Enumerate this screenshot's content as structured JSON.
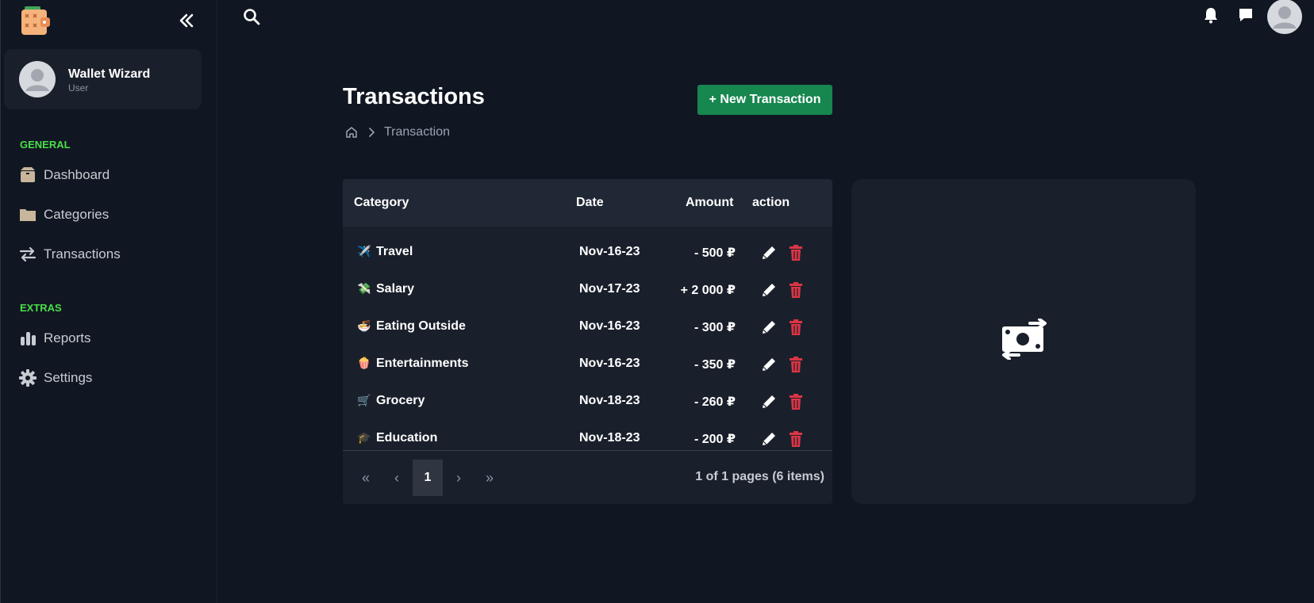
{
  "sidebar": {
    "user": {
      "name": "Wallet Wizard",
      "role": "User"
    },
    "sections": [
      {
        "title": "GENERAL",
        "items": [
          {
            "label": "Dashboard",
            "icon": "box-icon"
          },
          {
            "label": "Categories",
            "icon": "folder-icon"
          },
          {
            "label": "Transactions",
            "icon": "arrows-exchange-icon"
          }
        ]
      },
      {
        "title": "EXTRAS",
        "items": [
          {
            "label": "Reports",
            "icon": "bar-chart-icon"
          },
          {
            "label": "Settings",
            "icon": "gear-icon"
          }
        ]
      }
    ]
  },
  "header": {
    "title": "Transactions",
    "new_button": "+ New Transaction",
    "breadcrumb": "Transaction"
  },
  "table": {
    "columns": [
      "Category",
      "Date",
      "Amount",
      "action"
    ],
    "rows": [
      {
        "emoji": "✈️",
        "category": "Travel",
        "date": "Nov-16-23",
        "amount": "- 500 ₽"
      },
      {
        "emoji": "💸",
        "category": "Salary",
        "date": "Nov-17-23",
        "amount": "+ 2 000 ₽"
      },
      {
        "emoji": "🍜",
        "category": "Eating Outside",
        "date": "Nov-16-23",
        "amount": "- 300 ₽"
      },
      {
        "emoji": "🍿",
        "category": "Entertainments",
        "date": "Nov-16-23",
        "amount": "- 350 ₽"
      },
      {
        "emoji": "🛒",
        "category": "Grocery",
        "date": "Nov-18-23",
        "amount": "- 260 ₽"
      },
      {
        "emoji": "🎓",
        "category": "Education",
        "date": "Nov-18-23",
        "amount": "- 200 ₽"
      }
    ],
    "pagination": {
      "current": "1",
      "first": "«",
      "prev": "‹",
      "next": "›",
      "last": "»",
      "info": "1 of 1 pages (6 items)"
    }
  },
  "colors": {
    "background": "#111722",
    "card": "#1a202b",
    "accent_green": "#17864f",
    "section_green": "#4ade4a",
    "delete_red": "#dc3545"
  }
}
